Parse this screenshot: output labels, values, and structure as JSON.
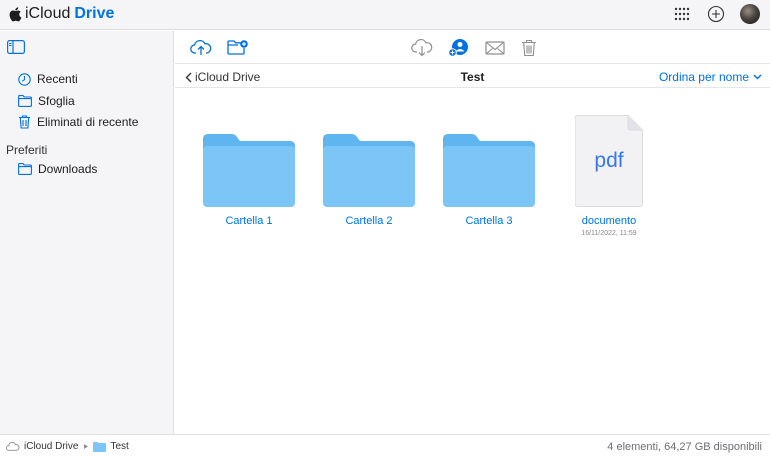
{
  "app": {
    "brand_word1": "iCloud",
    "brand_word2": "Drive"
  },
  "topbar": {
    "icons": [
      "app-grid-icon",
      "plus-circle-icon",
      "avatar"
    ]
  },
  "sidebar": {
    "items": [
      {
        "label": "Recenti",
        "icon": "clock-icon"
      },
      {
        "label": "Sfoglia",
        "icon": "folder-icon"
      },
      {
        "label": "Eliminati di recente",
        "icon": "trash-icon"
      }
    ],
    "section": "Preferiti",
    "favorites": [
      {
        "label": "Downloads",
        "icon": "folder-icon"
      }
    ]
  },
  "toolbar": {
    "left": [
      "upload-icon",
      "new-folder-icon"
    ],
    "center": [
      "download-icon",
      "share-user-icon",
      "mail-icon",
      "trash-icon"
    ]
  },
  "nav": {
    "back_label": "iCloud Drive",
    "title": "Test",
    "sort_label": "Ordina per nome"
  },
  "items": [
    {
      "name": "Cartella 1",
      "type": "folder"
    },
    {
      "name": "Cartella 2",
      "type": "folder"
    },
    {
      "name": "Cartella 3",
      "type": "folder"
    },
    {
      "name": "documento",
      "type": "pdf",
      "thumb_text": "pdf",
      "date": "16/11/2022, 11:59"
    }
  ],
  "footer": {
    "path": [
      "iCloud Drive",
      "Test"
    ],
    "status": "4 elementi, 64,27 GB disponibili"
  },
  "colors": {
    "accent": "#0071e3",
    "folder": "#7cc6f7",
    "folder_tab": "#5fb5ef",
    "sidebar_bg": "#f5f5f7"
  }
}
